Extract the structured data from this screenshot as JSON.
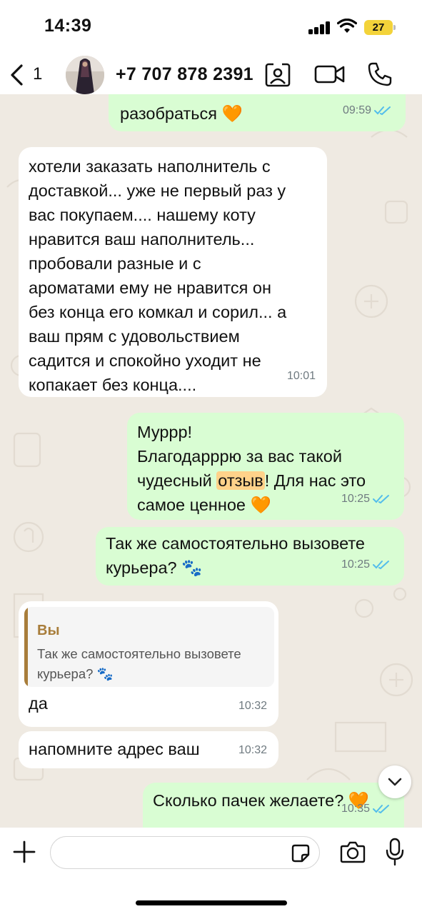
{
  "status_bar": {
    "time": "14:39",
    "battery": "27"
  },
  "header": {
    "back_count": "1",
    "contact_name": "+7 707 878 2391"
  },
  "messages": [
    {
      "text": "разобраться 🧡",
      "time": "09:59"
    },
    {
      "text": "хотели заказать наполнитель с\nдоставкой... уже не первый раз у\nвас покупаем....  нашему коту\nнравится ваш наполнитель...\nпробовали разные и с\nароматами ему не нравится он\nбез конца его комкал и сорил... а\nваш прям с удовольствием\nсадится и спокойно уходит не\nкопакает без конца....",
      "time": "10:01"
    },
    {
      "text_before": "Муррр!\nБлагодарррю за вас такой\nчудесный ",
      "highlight": "отзыв",
      "text_after": "! Для нас это\nсамое ценное 🧡",
      "time": "10:25"
    },
    {
      "text": "Так же самостоятельно вызовете\nкурьера? 🐾",
      "time": "10:25"
    },
    {
      "quote_author": "Вы",
      "quote_text": "Так же самостоятельно вызовете\nкурьера? 🐾",
      "text": "да",
      "time": "10:32"
    },
    {
      "text": "напомните адрес ваш",
      "time": "10:32"
    },
    {
      "text": "Сколько пачек желаете? 🧡",
      "time": "10:35"
    }
  ],
  "colors": {
    "outgoing": "#d9fdd3",
    "incoming": "#ffffff",
    "ticks": "#53bdeb",
    "quote_accent": "#a87d3a",
    "background": "#efeae2"
  },
  "icons": [
    "back-chevron-icon",
    "contact-card-icon",
    "video-call-icon",
    "phone-icon",
    "chevron-down-icon",
    "plus-icon",
    "sticker-icon",
    "camera-icon",
    "microphone-icon",
    "double-check-icon"
  ]
}
